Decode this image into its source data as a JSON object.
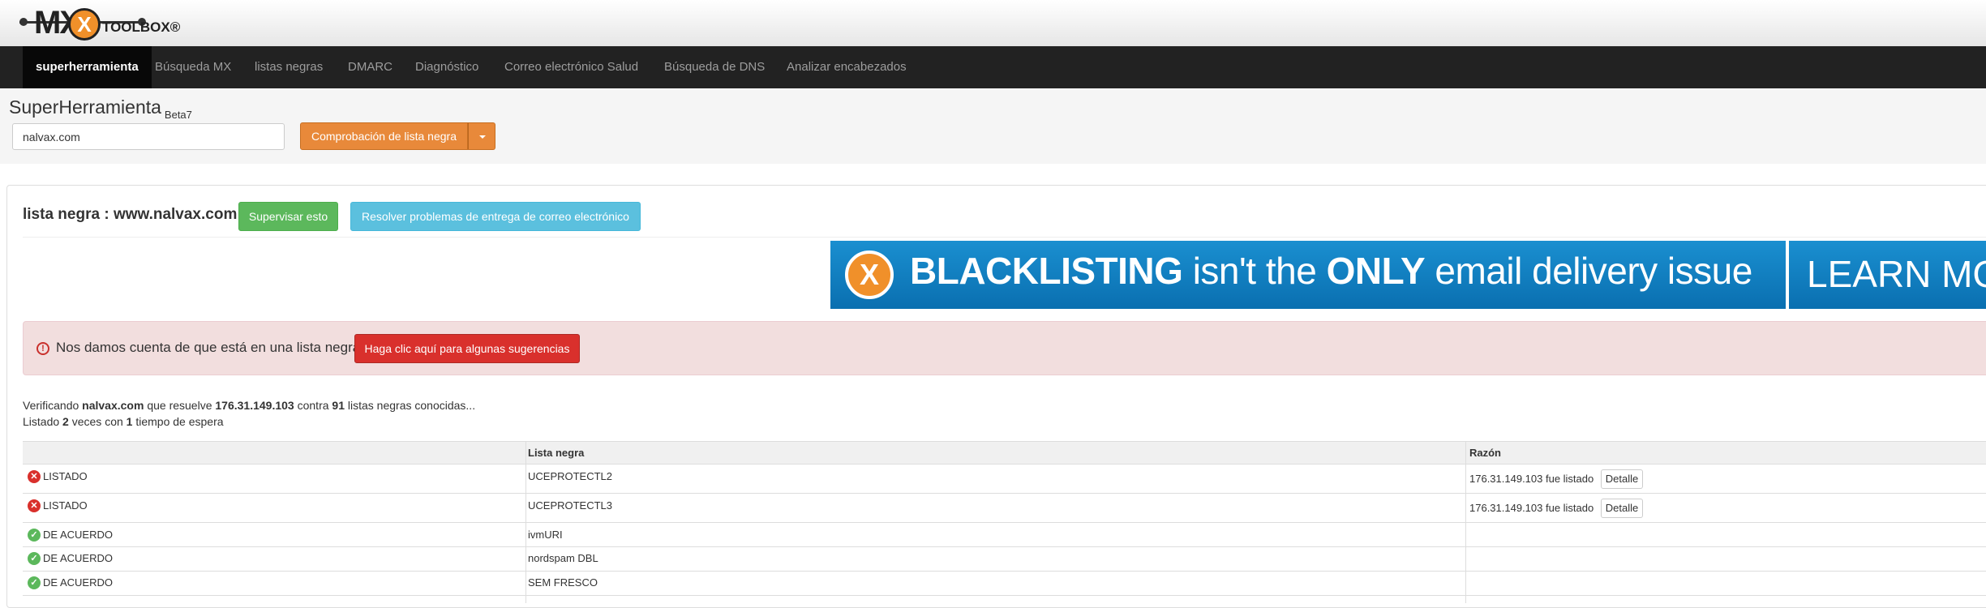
{
  "logo": {
    "mx": "MX",
    "x": "X",
    "toolbox": "TOOLBOX®"
  },
  "nav": [
    "superherramienta",
    "Búsqueda MX",
    "listas negras",
    "DMARC",
    "Diagnóstico",
    "Correo electrónico Salud",
    "Búsqueda de DNS",
    "Analizar encabezados"
  ],
  "tool": {
    "title": "SuperHerramienta",
    "beta": "Beta7",
    "input_value": "nalvax.com",
    "check_label": "Comprobación de lista negra"
  },
  "panel": {
    "title_prefix": "lista negra :",
    "title_domain": "www.nalvax.com",
    "monitor_label": "Supervisar esto",
    "resolve_label": "Resolver problemas de entrega de correo electrónico"
  },
  "banner": {
    "x": "X",
    "bold1": "BLACKLISTING",
    "mid": "isn't the",
    "bold2": "ONLY",
    "rest": "email delivery issue",
    "learn": "LEARN MORE"
  },
  "alert": {
    "text": "Nos damos cuenta de que está en una lista negra.",
    "button": "Haga clic aquí para algunas sugerencias"
  },
  "info": {
    "l1_a": "Verificando",
    "l1_domain": "nalvax.com",
    "l1_b": "que resuelve",
    "l1_ip": "176.31.149.103",
    "l1_c": "contra",
    "l1_count": "91",
    "l1_d": "listas negras conocidas...",
    "l2_a": "Listado",
    "l2_n": "2",
    "l2_b": "veces con",
    "l2_t": "1",
    "l2_c": "tiempo de espera"
  },
  "table": {
    "headers": [
      "",
      "Lista negra",
      "Razón"
    ],
    "rows": [
      {
        "status": "LISTADO",
        "list": "UCEPROTECTL2",
        "reason": "176.31.149.103 fue listado",
        "detail": "Detalle"
      },
      {
        "status": "LISTADO",
        "list": "UCEPROTECTL3",
        "reason": "176.31.149.103 fue listado",
        "detail": "Detalle"
      },
      {
        "status": "DE ACUERDO",
        "list": "ivmURI",
        "reason": "",
        "detail": ""
      },
      {
        "status": "DE ACUERDO",
        "list": "nordspam DBL",
        "reason": "",
        "detail": ""
      },
      {
        "status": "DE ACUERDO",
        "list": "SEM FRESCO",
        "reason": "",
        "detail": ""
      }
    ]
  },
  "colors": {
    "nav_bg": "#222222",
    "orange": "#e8893a",
    "green": "#5cb85c",
    "blue": "#5bc0de",
    "red": "#d9302c",
    "alert_bg": "#f2dede",
    "banner": "#1a8fd0"
  }
}
